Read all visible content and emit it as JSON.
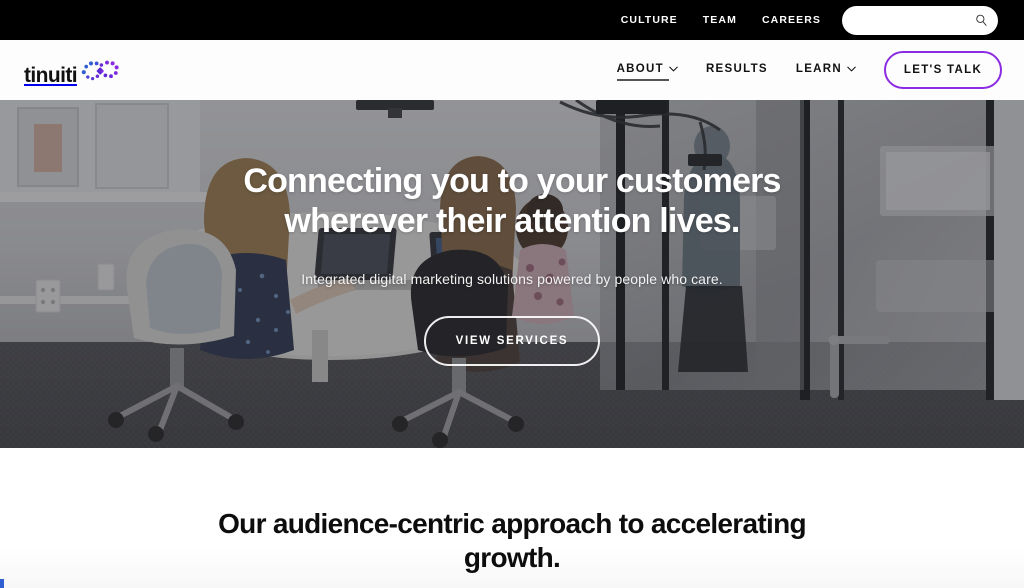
{
  "topbar": {
    "links": [
      {
        "label": "CULTURE",
        "name": "culture"
      },
      {
        "label": "TEAM",
        "name": "team"
      },
      {
        "label": "CAREERS",
        "name": "careers"
      }
    ],
    "search": {
      "value": "",
      "placeholder": "",
      "icon": "search-icon"
    },
    "background_color": "#000000"
  },
  "header": {
    "logo": {
      "word": "tinuiti",
      "mark": "dotted-infinity-swoosh"
    },
    "nav": [
      {
        "label": "ABOUT",
        "has_chevron": true,
        "active": true
      },
      {
        "label": "RESULTS",
        "has_chevron": false,
        "active": false
      },
      {
        "label": "LEARN",
        "has_chevron": true,
        "active": false
      }
    ],
    "cta": {
      "label": "LET'S TALK",
      "border_color": "#8B2BE2"
    }
  },
  "hero": {
    "title_line1": "Connecting you to your customers",
    "title_line2": "wherever their attention lives.",
    "subtitle": "Integrated digital marketing solutions powered by people who care.",
    "button_label": "VIEW SERVICES",
    "photo_alt": "office-meeting-room-photo"
  },
  "section": {
    "heading": "Our audience-centric approach to accelerating growth."
  },
  "colors": {
    "brand_purple": "#8B2BE2",
    "logo_blue": "#2f5fd0",
    "black": "#000000",
    "white": "#ffffff"
  }
}
